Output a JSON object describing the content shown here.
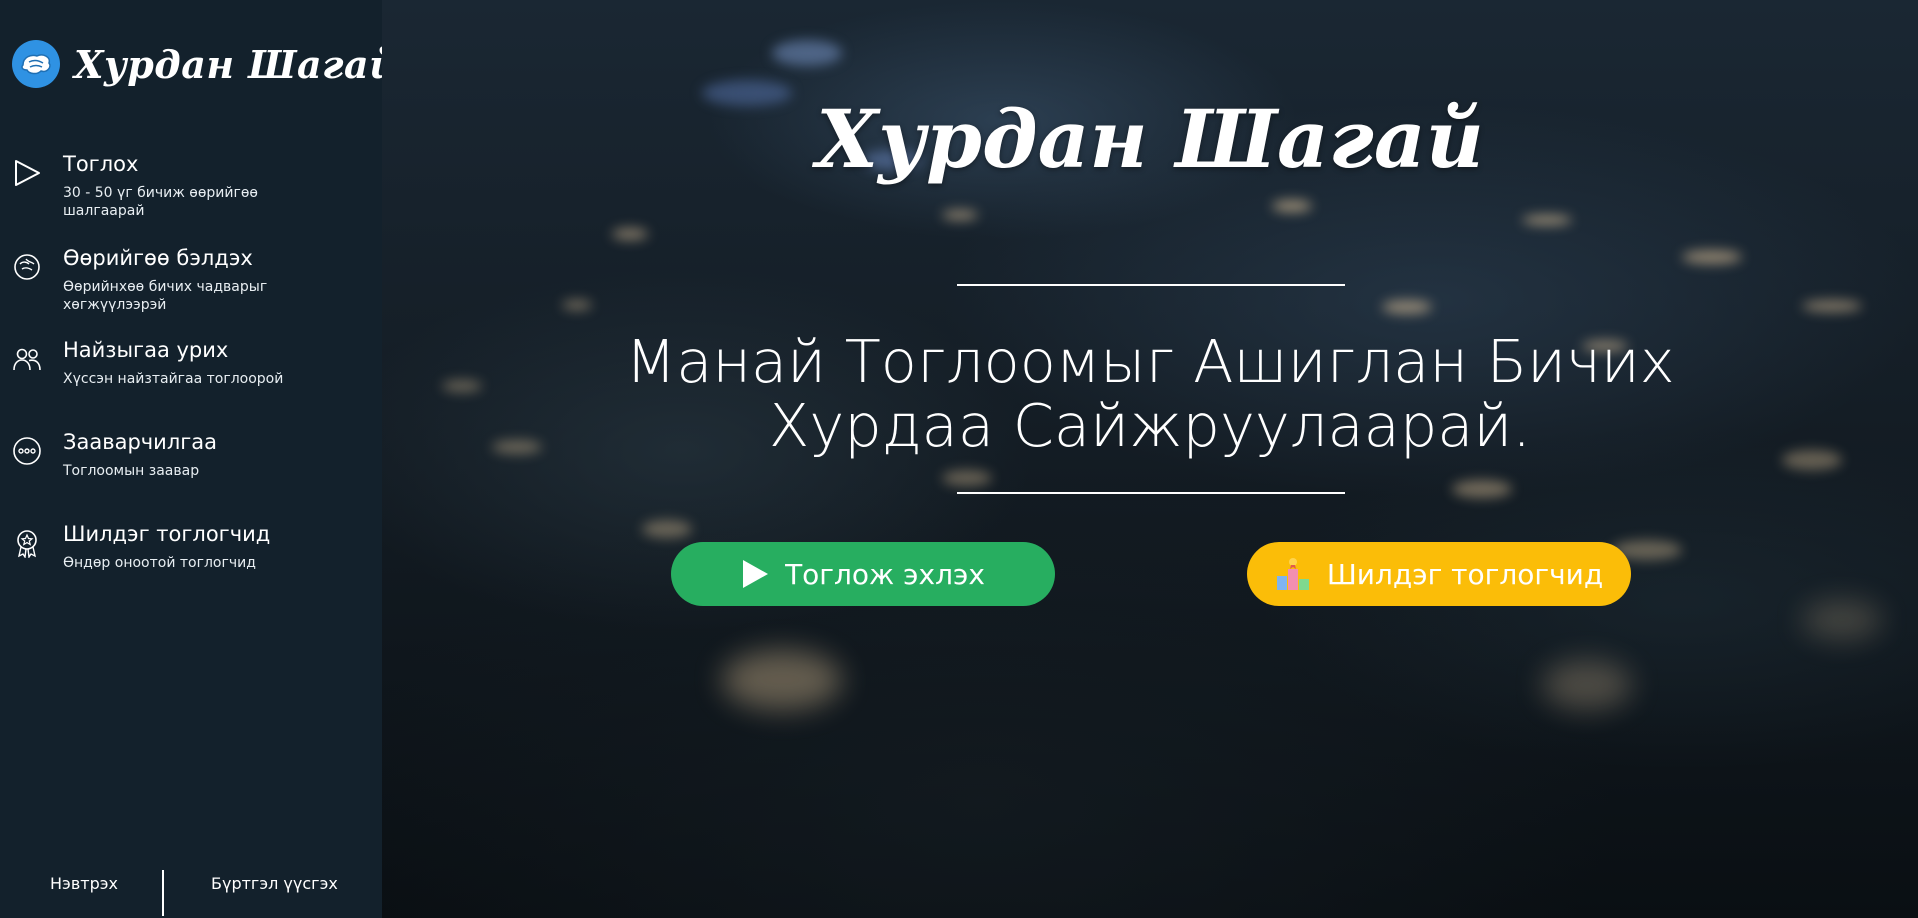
{
  "brand": {
    "name": "Хурдан Шагай",
    "accent": "#2f92e3"
  },
  "sidebar": {
    "items": [
      {
        "title": "Тоглох",
        "desc": "30 - 50 үг бичиж өөрийгөө шалгаарай",
        "icon": "play-icon"
      },
      {
        "title": "Өөрийгөө бэлдэх",
        "desc": "Өөрийнхөө бичих чадварыг хөгжүүлээрэй",
        "icon": "brain-icon"
      },
      {
        "title": "Найзыгаа урих",
        "desc": "Хүссэн найзтайгаа тоглоорой",
        "icon": "users-icon"
      },
      {
        "title": "Зааварчилгаа",
        "desc": "Тоглоомын заавар",
        "icon": "more-icon"
      },
      {
        "title": "Шилдэг тоглогчид",
        "desc": "Өндөр оноотой тоглогчид",
        "icon": "award-icon"
      }
    ],
    "login": "Нэвтрэх",
    "register": "Бүртгэл үүсгэх"
  },
  "hero": {
    "title": "Хурдан Шагай",
    "tagline_line1": "Манай Тоглоомыг Ашиглан Бичих",
    "tagline_line2": "Хурдаа Сайжруулаарай.",
    "play_button": "Тоглож эхлэх",
    "leaderboard_button": "Шилдэг тоглогчид",
    "colors": {
      "play": "#27ae60",
      "leaderboard": "#fbbd08"
    }
  }
}
